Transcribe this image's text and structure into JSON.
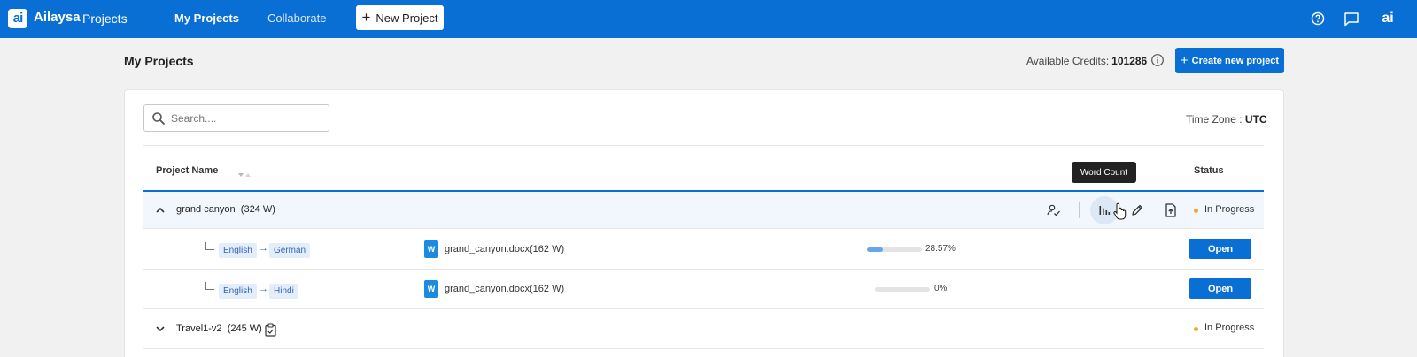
{
  "topbar": {
    "logo_text": "ai",
    "brand": "Ailaysa",
    "brand_sub": "Projects",
    "nav": [
      {
        "label": "My Projects",
        "active": true
      },
      {
        "label": "Collaborate",
        "active": false
      }
    ],
    "new_project_label": "New Project",
    "icons": [
      "help-icon",
      "chat-icon",
      "ai-logo-icon"
    ],
    "avatar_text": "ai"
  },
  "header": {
    "title": "My Projects",
    "credits_label": "Available Credits:",
    "credits_value": "101286",
    "create_label": "Create new project"
  },
  "toolbar": {
    "search_placeholder": "Search....",
    "timezone_label": "Time Zone :",
    "timezone_value": "UTC"
  },
  "table": {
    "columns": {
      "name": "Project Name",
      "status": "Status"
    },
    "tooltip": "Word Count",
    "projects": [
      {
        "name": "grand canyon",
        "words": "(324 W)",
        "expanded": true,
        "status": "In Progress",
        "tasks": [
          {
            "source": "English",
            "target": "German",
            "doc_letter": "W",
            "file": "grand_canyon.docx(162 W)",
            "progress": 28.57,
            "progress_text": "28.57%",
            "action": "Open"
          },
          {
            "source": "English",
            "target": "Hindi",
            "doc_letter": "W",
            "file": "grand_canyon.docx(162 W)",
            "progress": 0,
            "progress_text": "0%",
            "action": "Open"
          }
        ]
      },
      {
        "name": "Travel1-v2",
        "words": "(245 W)",
        "expanded": false,
        "status": "In Progress",
        "tasks": []
      }
    ]
  },
  "colors": {
    "primary": "#0a6fd4",
    "status_in_progress": "#f5a623",
    "chip_bg": "#e4eefa",
    "progress_fill": "#6aa4ea"
  }
}
